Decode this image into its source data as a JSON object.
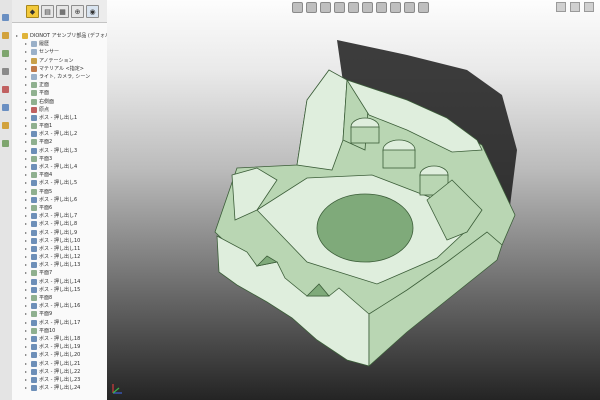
{
  "window": {
    "title": ""
  },
  "tree_toolbar": {
    "buttons": [
      {
        "icon": "featuremanager-icon"
      },
      {
        "icon": "propertymanager-icon"
      },
      {
        "icon": "configurationmanager-icon"
      },
      {
        "icon": "dimxpert-icon"
      },
      {
        "icon": "display-manager-icon"
      }
    ]
  },
  "tree": {
    "items": [
      {
        "label": "DIONOT アセンブリ部品 (デフォルト<",
        "level": 0,
        "icon_color": "#e0b43a"
      },
      {
        "label": "履歴",
        "level": 1,
        "icon_color": "#9ab0c8"
      },
      {
        "label": "センサー",
        "level": 1,
        "icon_color": "#9ab0c8"
      },
      {
        "label": "アノテーション",
        "level": 1,
        "icon_color": "#c9a14a"
      },
      {
        "label": "マテリアル <指定>",
        "level": 1,
        "icon_color": "#c07a4a"
      },
      {
        "label": "ライト, カメラ, シーン",
        "level": 1,
        "icon_color": "#9ab0c8"
      },
      {
        "label": "正面",
        "level": 1,
        "icon_color": "#8fb08f"
      },
      {
        "label": "平面",
        "level": 1,
        "icon_color": "#8fb08f"
      },
      {
        "label": "右側面",
        "level": 1,
        "icon_color": "#8fb08f"
      },
      {
        "label": "原点",
        "level": 1,
        "icon_color": "#c06060"
      },
      {
        "label": "ボス - 押し出し1",
        "level": 1,
        "icon_color": "#6d8fb8"
      },
      {
        "label": "平面1",
        "level": 1,
        "icon_color": "#8fb08f"
      },
      {
        "label": "ボス - 押し出し2",
        "level": 1,
        "icon_color": "#6d8fb8"
      },
      {
        "label": "平面2",
        "level": 1,
        "icon_color": "#8fb08f"
      },
      {
        "label": "ボス - 押し出し3",
        "level": 1,
        "icon_color": "#6d8fb8"
      },
      {
        "label": "平面3",
        "level": 1,
        "icon_color": "#8fb08f"
      },
      {
        "label": "ボス - 押し出し4",
        "level": 1,
        "icon_color": "#6d8fb8"
      },
      {
        "label": "平面4",
        "level": 1,
        "icon_color": "#8fb08f"
      },
      {
        "label": "ボス - 押し出し5",
        "level": 1,
        "icon_color": "#6d8fb8"
      },
      {
        "label": "平面5",
        "level": 1,
        "icon_color": "#8fb08f"
      },
      {
        "label": "ボス - 押し出し6",
        "level": 1,
        "icon_color": "#6d8fb8"
      },
      {
        "label": "平面6",
        "level": 1,
        "icon_color": "#8fb08f"
      },
      {
        "label": "ボス - 押し出し7",
        "level": 1,
        "icon_color": "#6d8fb8"
      },
      {
        "label": "ボス - 押し出し8",
        "level": 1,
        "icon_color": "#6d8fb8"
      },
      {
        "label": "ボス - 押し出し9",
        "level": 1,
        "icon_color": "#6d8fb8"
      },
      {
        "label": "ボス - 押し出し10",
        "level": 1,
        "icon_color": "#6d8fb8"
      },
      {
        "label": "ボス - 押し出し11",
        "level": 1,
        "icon_color": "#6d8fb8"
      },
      {
        "label": "ボス - 押し出し12",
        "level": 1,
        "icon_color": "#6d8fb8"
      },
      {
        "label": "ボス - 押し出し13",
        "level": 1,
        "icon_color": "#6d8fb8"
      },
      {
        "label": "平面7",
        "level": 1,
        "icon_color": "#8fb08f"
      },
      {
        "label": "ボス - 押し出し14",
        "level": 1,
        "icon_color": "#6d8fb8"
      },
      {
        "label": "ボス - 押し出し15",
        "level": 1,
        "icon_color": "#6d8fb8"
      },
      {
        "label": "平面8",
        "level": 1,
        "icon_color": "#8fb08f"
      },
      {
        "label": "ボス - 押し出し16",
        "level": 1,
        "icon_color": "#6d8fb8"
      },
      {
        "label": "平面9",
        "level": 1,
        "icon_color": "#8fb08f"
      },
      {
        "label": "ボス - 押し出し17",
        "level": 1,
        "icon_color": "#6d8fb8"
      },
      {
        "label": "平面10",
        "level": 1,
        "icon_color": "#8fb08f"
      },
      {
        "label": "ボス - 押し出し18",
        "level": 1,
        "icon_color": "#6d8fb8"
      },
      {
        "label": "ボス - 押し出し19",
        "level": 1,
        "icon_color": "#6d8fb8"
      },
      {
        "label": "ボス - 押し出し20",
        "level": 1,
        "icon_color": "#6d8fb8"
      },
      {
        "label": "ボス - 押し出し21",
        "level": 1,
        "icon_color": "#6d8fb8"
      },
      {
        "label": "ボス - 押し出し22",
        "level": 1,
        "icon_color": "#6d8fb8"
      },
      {
        "label": "ボス - 押し出し23",
        "level": 1,
        "icon_color": "#6d8fb8"
      },
      {
        "label": "ボス - 押し出し24",
        "level": 1,
        "icon_color": "#6d8fb8"
      }
    ]
  },
  "viewport": {
    "model_colors": {
      "face_light": "#dfeedd",
      "face_mid": "#b9d6b3",
      "face_dark": "#7faa7a",
      "edge": "#3c5e39",
      "shadow": "#1c1c1c"
    },
    "hud_icons": [
      "zoom-fit-icon",
      "zoom-area-icon",
      "previous-view-icon",
      "section-view-icon",
      "view-orientation-icon",
      "display-style-icon",
      "hide-show-icon",
      "edit-appearance-icon",
      "scene-icon",
      "view-settings-icon"
    ]
  }
}
